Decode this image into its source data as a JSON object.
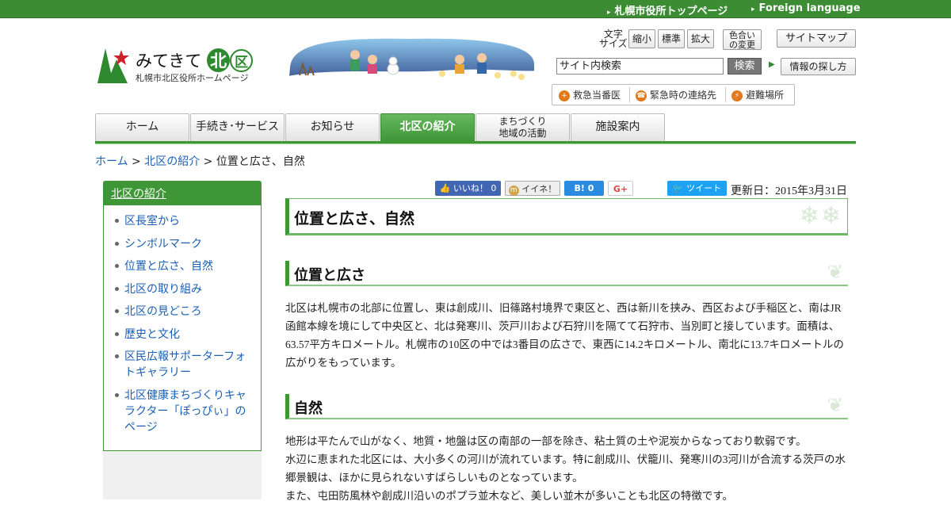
{
  "topbar": {
    "links": [
      "札幌市役所トップページ",
      "Foreign language"
    ]
  },
  "logo": {
    "title_pre": "みてきて",
    "title_badge1": "北",
    "title_badge2": "区",
    "subtitle": "札幌市北区役所ホームページ"
  },
  "font_size": {
    "label": "文字\nサイズ",
    "small": "縮小",
    "standard": "標準",
    "large": "拡大"
  },
  "color_change": "色合い\nの変更",
  "sitemap": "サイトマップ",
  "search": {
    "value": "サイト内検索",
    "button": "検索"
  },
  "info_link": "情報の探し方",
  "emergency": [
    {
      "label": "救急当番医",
      "icon": "hospital-icon"
    },
    {
      "label": "緊急時の連絡先",
      "icon": "phone-icon"
    },
    {
      "label": "避難場所",
      "icon": "lightning-icon"
    }
  ],
  "nav": [
    "ホーム",
    "手続き･サービス",
    "お知らせ",
    "北区の紹介",
    "まちづくり\n地域の活動",
    "施設案内"
  ],
  "breadcrumb": {
    "home": "ホーム",
    "sep1": " > ",
    "section": "北区の紹介",
    "sep2": " > ",
    "current": "位置と広さ、自然"
  },
  "sidebar": {
    "heading": "北区の紹介",
    "items": [
      "区長室から",
      "シンボルマーク",
      "位置と広さ、自然",
      "北区の取り組み",
      "北区の見どころ",
      "歴史と文化",
      "区民広報サポーターフォトギャラリー",
      "北区健康まちづくりキャラクター「ぽっぴぃ」のページ"
    ]
  },
  "social": {
    "fb": "いいね！",
    "fb_count": "0",
    "mixi": "イイネ！",
    "hatena": "B!",
    "hatena_count": "0",
    "gplus": "G+",
    "twitter": "ツイート"
  },
  "updated": "更新日：2015年3月31日",
  "page_title": "位置と広さ、自然",
  "sections": [
    {
      "heading": "位置と広さ",
      "paragraphs": [
        "北区は札幌市の北部に位置し、東は創成川、旧篠路村境界で東区と、西は新川を挟み、西区および手稲区と、南はJR函館本線を境にして中央区と、北は発寒川、茨戸川および石狩川を隔てて石狩市、当別町と接しています。面積は、63.57平方キロメートル。札幌市の10区の中では3番目の広さで、東西に14.2キロメートル、南北に13.7キロメートルの広がりをもっています。"
      ]
    },
    {
      "heading": "自然",
      "paragraphs": [
        "地形は平たんで山がなく、地質・地盤は区の南部の一部を除き、粘土質の土や泥炭からなっており軟弱です。",
        "水辺に恵まれた北区には、大小多くの河川が流れています。特に創成川、伏籠川、発寒川の3河川が合流する茨戸の水郷景観は、ほかに見られないすばらしいものとなっています。",
        "また、屯田防風林や創成川沿いのポプラ並木など、美しい並木が多いことも北区の特徴です。"
      ]
    }
  ],
  "colors": {
    "brand_green": "#3e9636",
    "logo_star": "#d0202a"
  }
}
